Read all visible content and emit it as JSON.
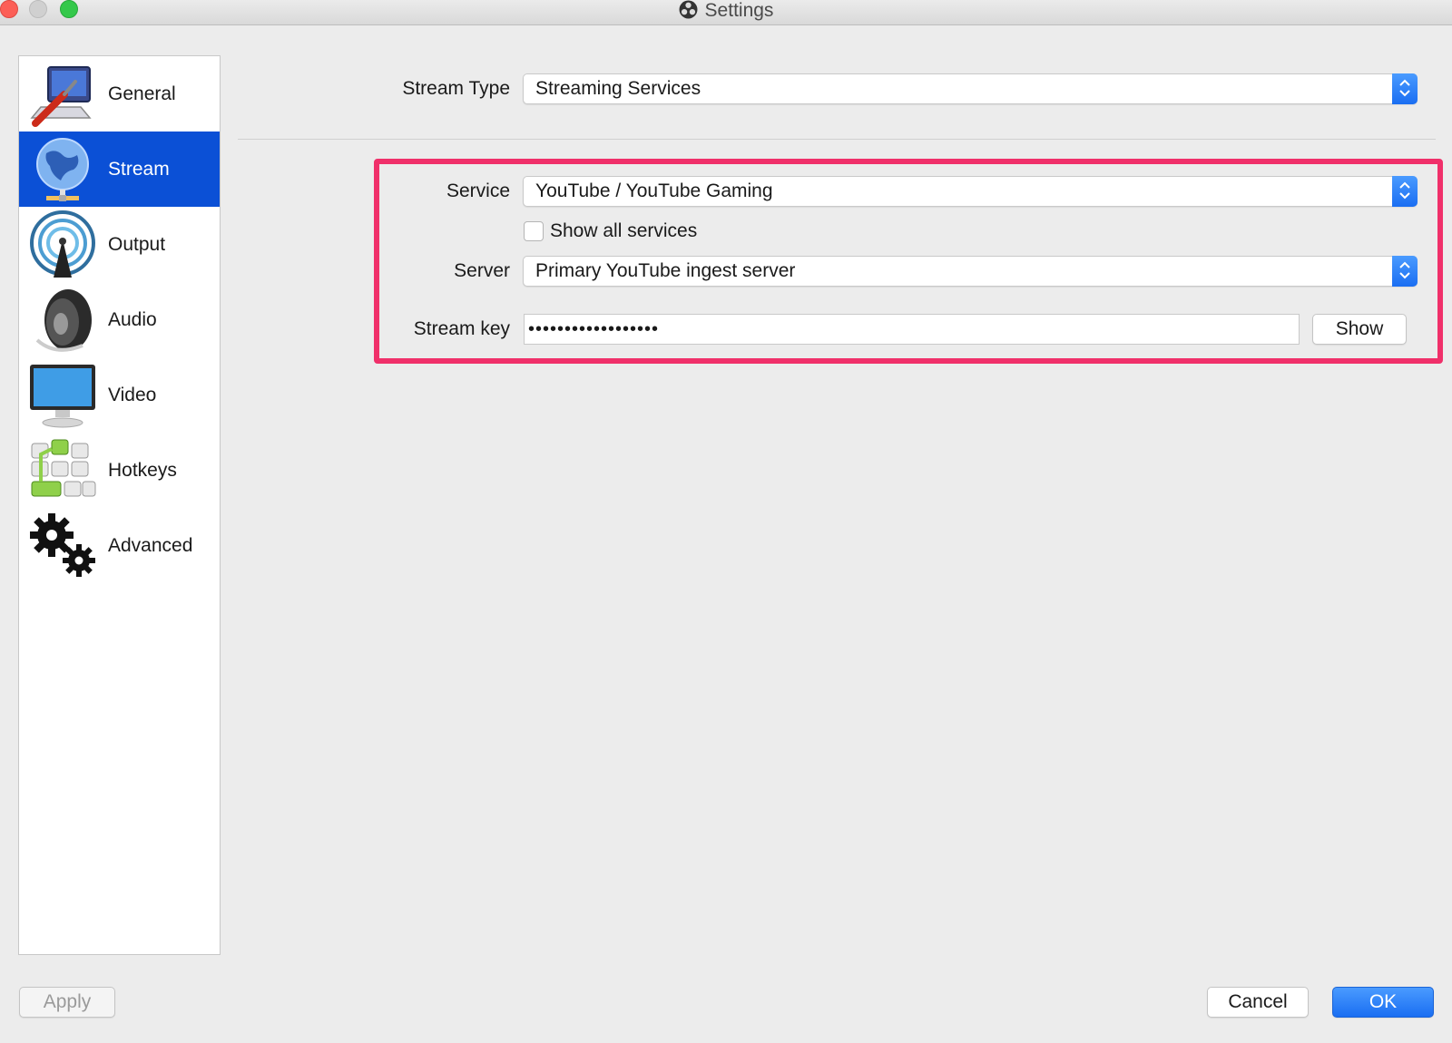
{
  "window": {
    "title": "Settings"
  },
  "sidebar": {
    "items": [
      {
        "label": "General",
        "icon": "general-icon",
        "active": false
      },
      {
        "label": "Stream",
        "icon": "globe-icon",
        "active": true
      },
      {
        "label": "Output",
        "icon": "output-icon",
        "active": false
      },
      {
        "label": "Audio",
        "icon": "speaker-icon",
        "active": false
      },
      {
        "label": "Video",
        "icon": "monitor-icon",
        "active": false
      },
      {
        "label": "Hotkeys",
        "icon": "keyboard-icon",
        "active": false
      },
      {
        "label": "Advanced",
        "icon": "gears-icon",
        "active": false
      }
    ]
  },
  "stream": {
    "stream_type_label": "Stream Type",
    "stream_type_value": "Streaming Services",
    "service_label": "Service",
    "service_value": "YouTube / YouTube Gaming",
    "show_all_label": "Show all services",
    "show_all_checked": false,
    "server_label": "Server",
    "server_value": "Primary YouTube ingest server",
    "key_label": "Stream key",
    "key_value": "••••••••••••••••••",
    "show_button": "Show"
  },
  "footer": {
    "apply": "Apply",
    "cancel": "Cancel",
    "ok": "OK"
  },
  "colors": {
    "accent": "#0b50d6",
    "highlight": "#f0306a"
  }
}
